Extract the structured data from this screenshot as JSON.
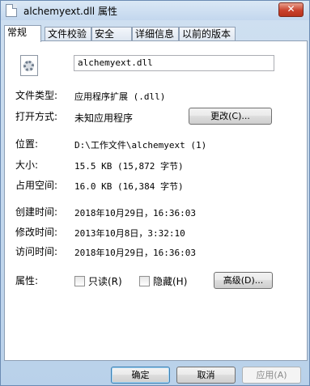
{
  "window": {
    "title": "alchemyext.dll 属性",
    "close_label": "✕"
  },
  "tabs": [
    {
      "label": "常规",
      "active": true
    },
    {
      "label": "文件校验",
      "active": false
    },
    {
      "label": "安全",
      "active": false
    },
    {
      "label": "详细信息",
      "active": false
    },
    {
      "label": "以前的版本",
      "active": false
    }
  ],
  "general": {
    "filename": "alchemyext.dll",
    "type_label": "文件类型:",
    "type_value": "应用程序扩展 (.dll)",
    "opens_label": "打开方式:",
    "opens_value": "未知应用程序",
    "change_button": "更改(C)...",
    "location_label": "位置:",
    "location_value": "D:\\工作文件\\alchemyext (1)",
    "size_label": "大小:",
    "size_value": "15.5 KB (15,872 字节)",
    "size_on_disk_label": "占用空间:",
    "size_on_disk_value": "16.0 KB (16,384 字节)",
    "created_label": "创建时间:",
    "created_value": "2018年10月29日，16:36:03",
    "modified_label": "修改时间:",
    "modified_value": "2013年10月8日，3:32:10",
    "accessed_label": "访问时间:",
    "accessed_value": "2018年10月29日，16:36:03",
    "attributes_label": "属性:",
    "readonly_label": "只读(R)",
    "hidden_label": "隐藏(H)",
    "advanced_button": "高级(D)..."
  },
  "footer": {
    "ok_label": "确定",
    "cancel_label": "取消",
    "apply_label": "应用(A)"
  }
}
